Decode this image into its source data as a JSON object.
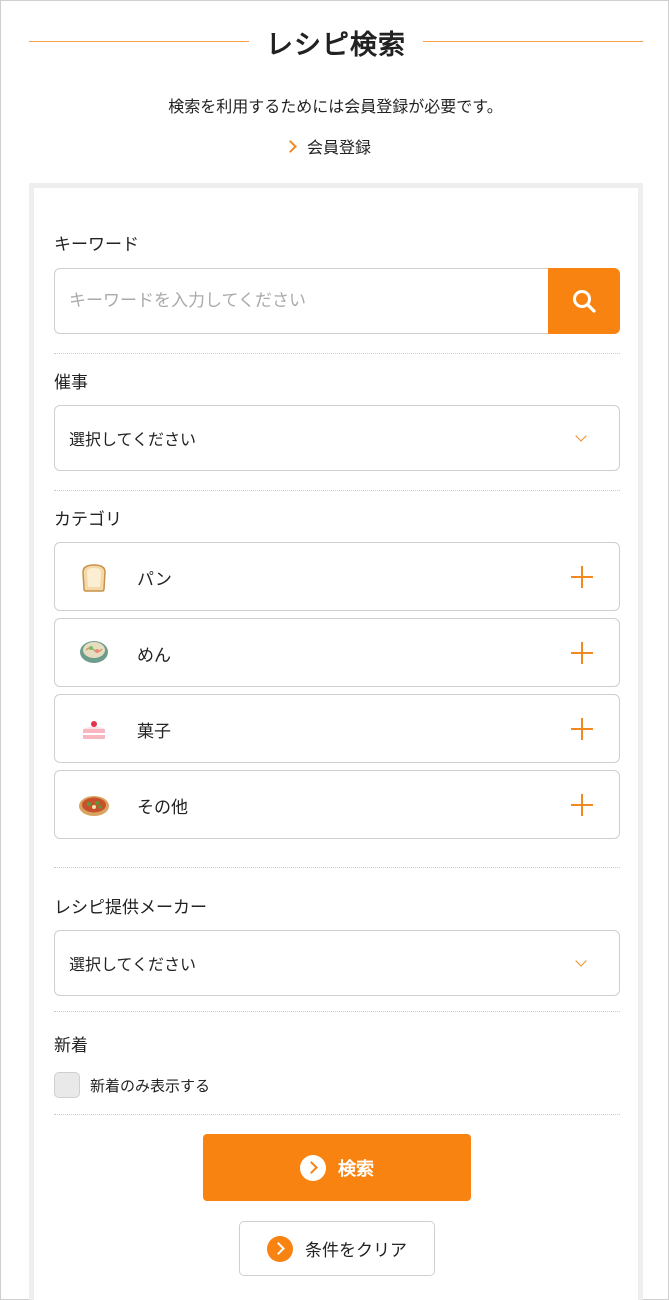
{
  "header": {
    "title": "レシピ検索",
    "notice": "検索を利用するためには会員登録が必要です。",
    "register_link": "会員登録"
  },
  "keyword": {
    "label": "キーワード",
    "placeholder": "キーワードを入力してください",
    "value": ""
  },
  "event": {
    "label": "催事",
    "selected": "選択してください"
  },
  "category": {
    "label": "カテゴリ",
    "items": [
      {
        "name": "パン",
        "icon": "bread-icon"
      },
      {
        "name": "めん",
        "icon": "noodle-bowl-icon"
      },
      {
        "name": "菓子",
        "icon": "cake-icon"
      },
      {
        "name": "その他",
        "icon": "pizza-icon"
      }
    ]
  },
  "maker": {
    "label": "レシピ提供メーカー",
    "selected": "選択してください"
  },
  "new_arrivals": {
    "label": "新着",
    "checkbox_label": "新着のみ表示する",
    "checked": false
  },
  "actions": {
    "search_label": "検索",
    "clear_label": "条件をクリア"
  },
  "colors": {
    "accent": "#f98311",
    "accent_line": "#f7a04d",
    "border": "#cfcfcf",
    "panel_border": "#eeeeee"
  }
}
